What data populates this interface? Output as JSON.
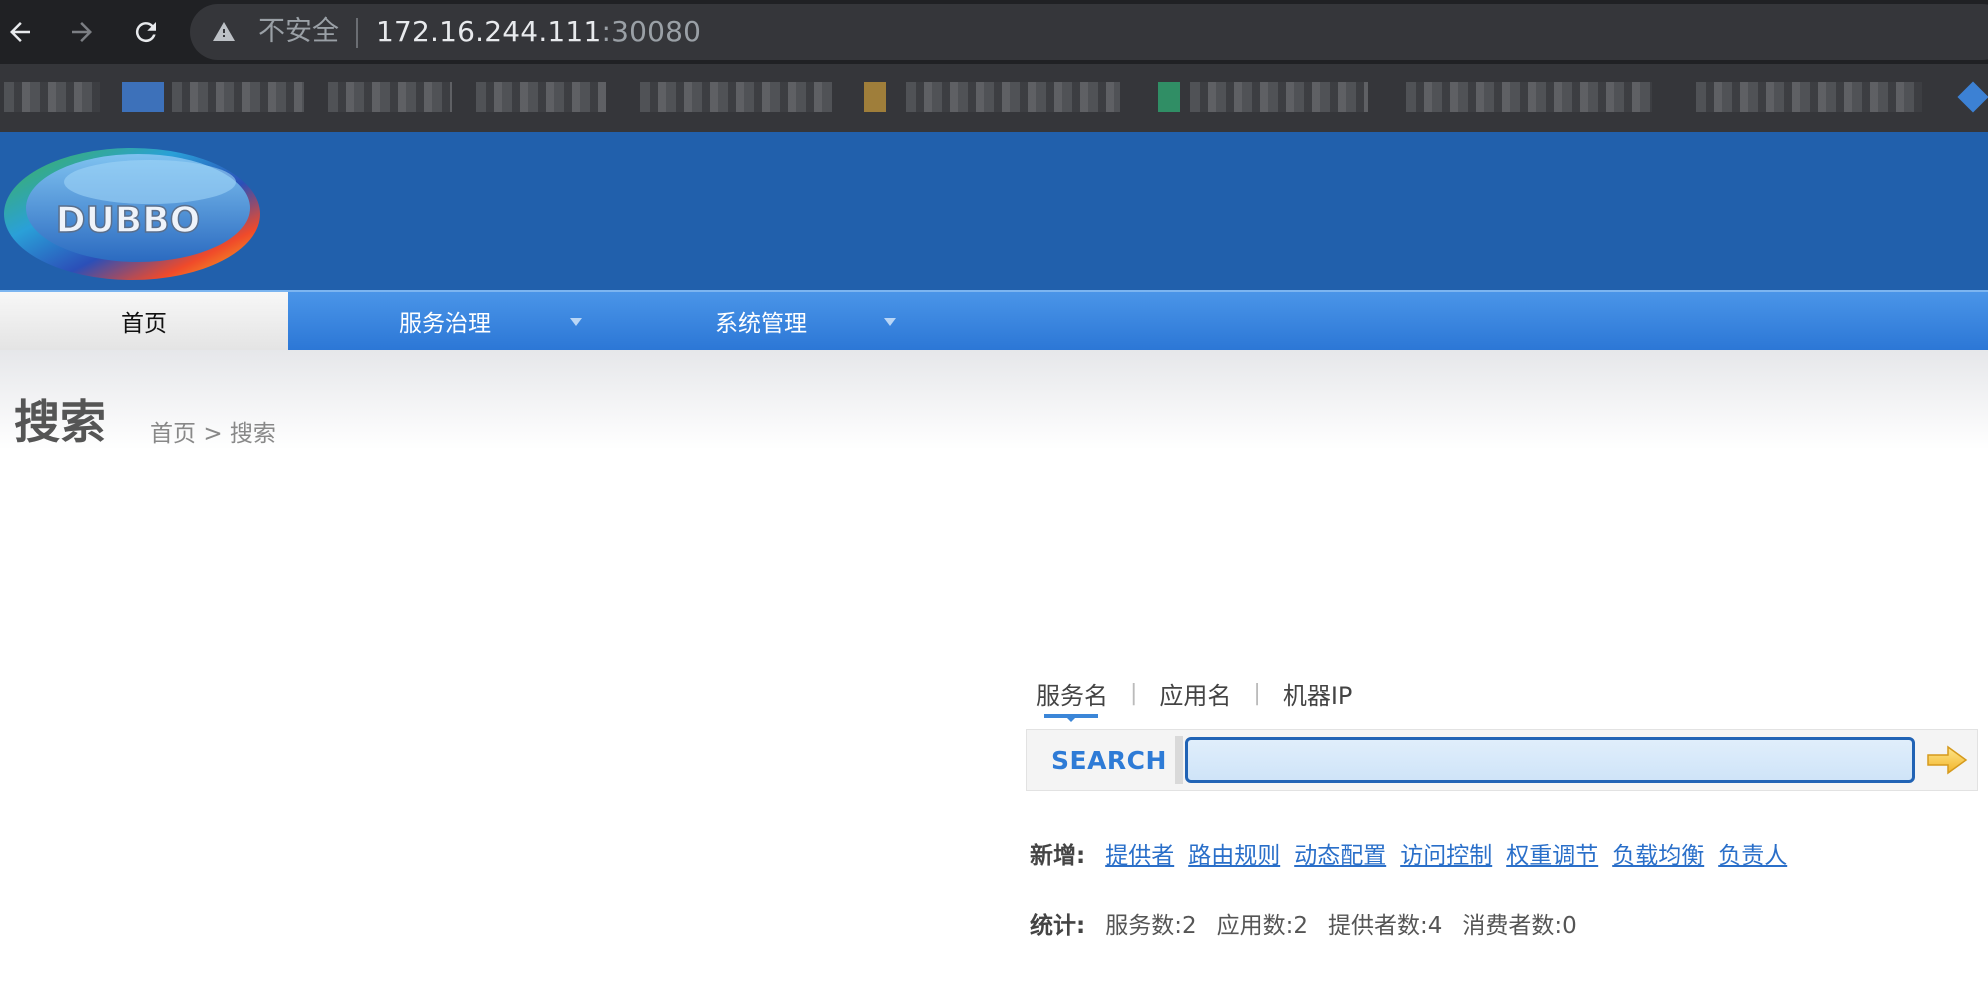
{
  "browser": {
    "security_label": "不安全",
    "url_host": "172.16.244.111",
    "url_port": ":30080"
  },
  "app": {
    "logo_text": "DUBBO",
    "menu": [
      {
        "label": "首页"
      },
      {
        "label": "服务治理"
      },
      {
        "label": "系统管理"
      }
    ]
  },
  "page": {
    "title": "搜索",
    "breadcrumb": {
      "home": "首页",
      "separator": ">",
      "current": "搜索"
    }
  },
  "search": {
    "tabs": [
      {
        "label": "服务名"
      },
      {
        "label": "应用名"
      },
      {
        "label": "机器IP"
      }
    ],
    "tab_separator": "|",
    "label": "SEARCH",
    "value": "",
    "placeholder": ""
  },
  "add_row": {
    "label": "新增:",
    "links": [
      {
        "label": "提供者"
      },
      {
        "label": "路由规则"
      },
      {
        "label": "动态配置"
      },
      {
        "label": "访问控制"
      },
      {
        "label": "权重调节"
      },
      {
        "label": "负载均衡"
      },
      {
        "label": "负责人"
      }
    ]
  },
  "stats_row": {
    "label": "统计:",
    "items": [
      {
        "text": "服务数:2"
      },
      {
        "text": "应用数:2"
      },
      {
        "text": "提供者数:4"
      },
      {
        "text": "消费者数:0"
      }
    ]
  },
  "colors": {
    "header": "#2160ac",
    "menubar": "#3a86de",
    "link": "#2a6fc9"
  }
}
